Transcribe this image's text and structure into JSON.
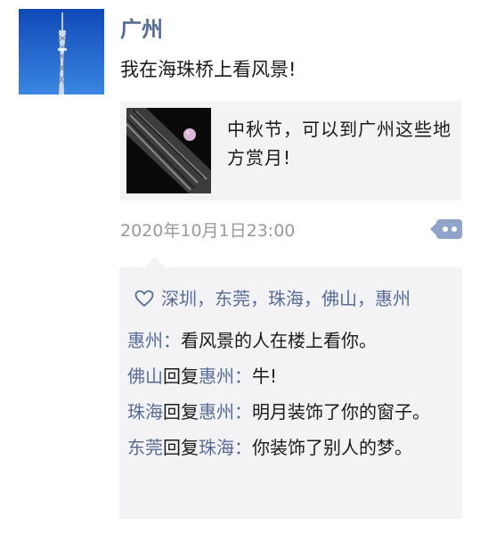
{
  "post": {
    "author": "广州",
    "avatar_icon": "canton-tower-photo",
    "text": "我在海珠桥上看风景!",
    "link": {
      "title": "中秋节，可以到广州这些地方赏月!",
      "thumbnail_icon": "moon-over-building-photo"
    },
    "timestamp": "2020年10月1日23:00",
    "more_icon": "comment-more-icon"
  },
  "likes": {
    "icon": "heart-icon",
    "separator": "，",
    "names": [
      "深圳",
      "东莞",
      "珠海",
      "佛山",
      "惠州"
    ]
  },
  "comments": {
    "reply_word": "回复",
    "colon": "：",
    "items": [
      {
        "author": "惠州",
        "reply_to": "",
        "text": "看风景的人在楼上看你。"
      },
      {
        "author": "佛山",
        "reply_to": "惠州",
        "text": "牛!"
      },
      {
        "author": "珠海",
        "reply_to": "惠州",
        "text": "明月装饰了你的窗子。"
      },
      {
        "author": "东莞",
        "reply_to": "珠海",
        "text": "你装饰了别人的梦。"
      }
    ]
  },
  "colors": {
    "name_blue": "#576b95",
    "panel_bg": "#f3f3f5",
    "timestamp_gray": "#9a9a9a",
    "text": "#1a1a1a"
  }
}
